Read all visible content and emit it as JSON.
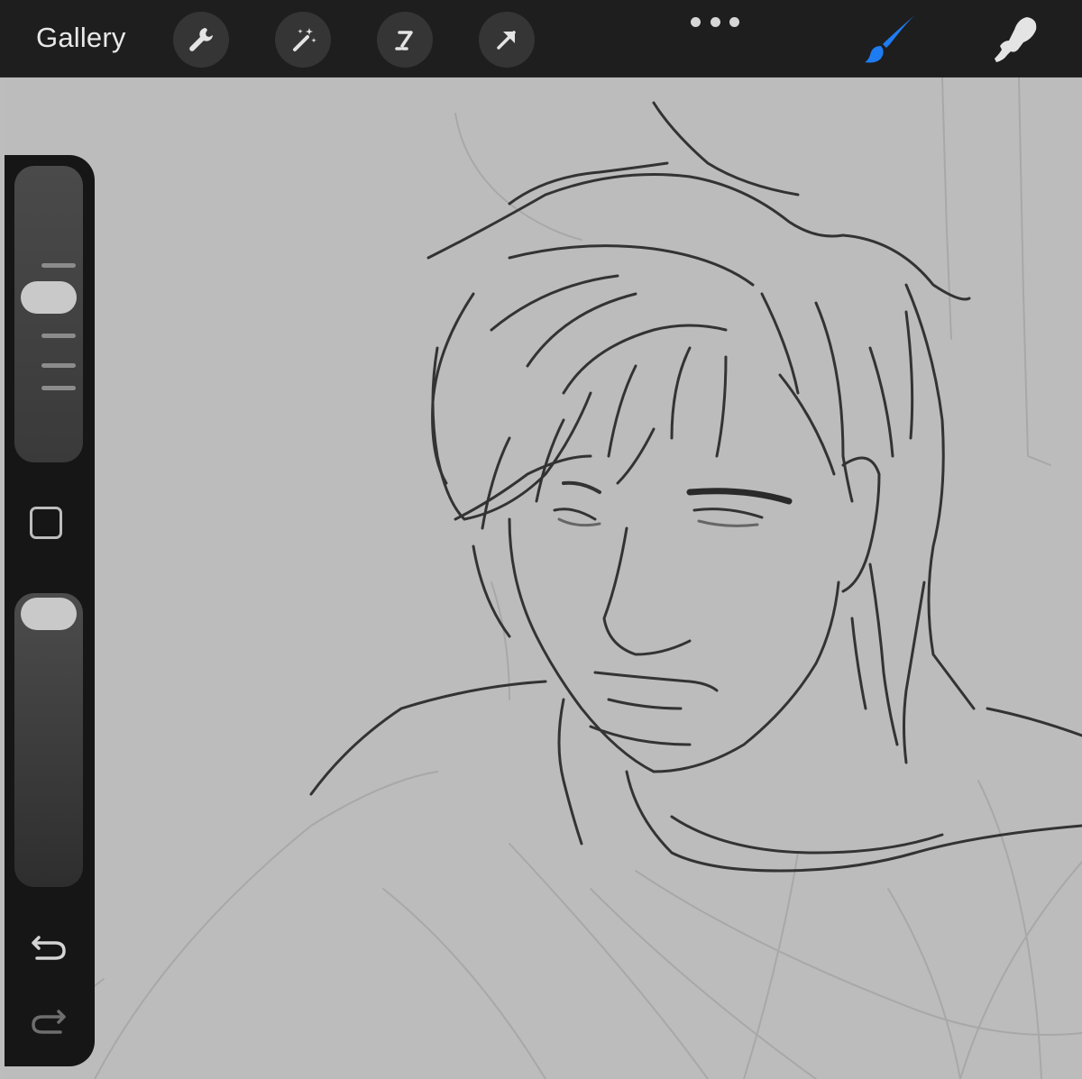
{
  "topbar": {
    "gallery_label": "Gallery",
    "tools": [
      {
        "icon": "wrench-icon",
        "name": "actions"
      },
      {
        "icon": "magic-wand-icon",
        "name": "adjustments"
      },
      {
        "icon": "selection-icon",
        "name": "selection"
      },
      {
        "icon": "transform-arrow-icon",
        "name": "transform"
      }
    ],
    "more_icon": "more-dots-icon",
    "right_tools": [
      {
        "icon": "brush-icon",
        "name": "paint",
        "active": true,
        "color": "#1e7cf2"
      },
      {
        "icon": "smudge-icon",
        "name": "smudge",
        "active": false,
        "color": "#e4e4e4"
      }
    ]
  },
  "sidebar": {
    "brush_size_fraction": 0.4,
    "opacity_fraction": 0.0,
    "modify_button_icon": "square-icon",
    "undo_icon": "undo-icon",
    "redo_icon": "redo-icon"
  },
  "canvas": {
    "content": "pencil-sketch",
    "background_color": "#bcbcbc"
  },
  "colors": {
    "toolbar_bg": "#1e1e1e",
    "accent_blue": "#1e7cf2",
    "sidebar_bg": "#161616"
  }
}
